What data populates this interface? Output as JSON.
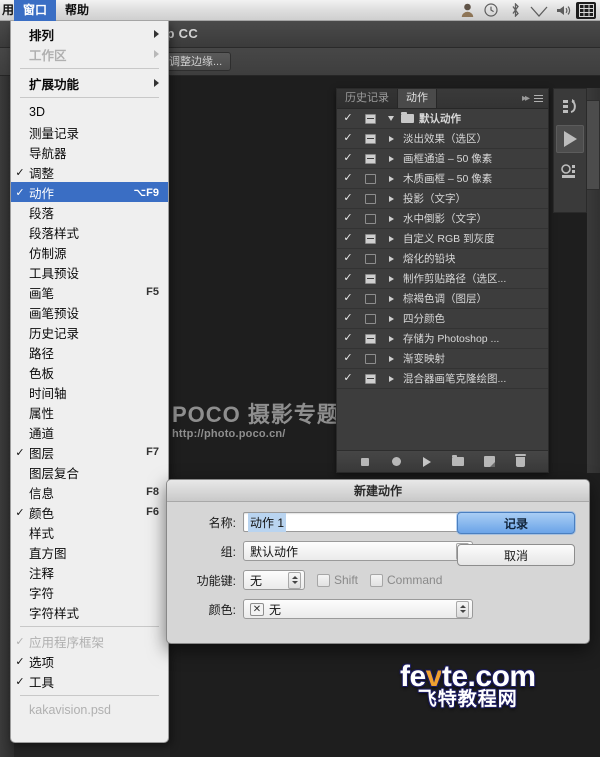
{
  "menubar": {
    "left_truncated": "用",
    "items": [
      {
        "label": "窗口",
        "selected": true
      },
      {
        "label": "帮助",
        "selected": false
      }
    ],
    "status_icons": [
      "user-icon",
      "clock-icon",
      "bluetooth-icon",
      "wifi-icon",
      "volume-icon",
      "input-method-icon"
    ]
  },
  "app": {
    "title": "hop CC",
    "refine_edge_button": "调整边缘..."
  },
  "window_menu": {
    "items": [
      {
        "label": "排列",
        "submenu": true,
        "checked": false,
        "disabled": false,
        "shortcut": ""
      },
      {
        "label": "工作区",
        "submenu": true,
        "checked": false,
        "disabled": true,
        "shortcut": ""
      },
      {
        "sep": true
      },
      {
        "label": "扩展功能",
        "submenu": true,
        "checked": false,
        "disabled": false,
        "shortcut": ""
      },
      {
        "sep": true
      },
      {
        "label": "3D",
        "submenu": false,
        "checked": false,
        "disabled": false,
        "shortcut": ""
      },
      {
        "label": "测量记录",
        "submenu": false,
        "checked": false,
        "disabled": false,
        "shortcut": ""
      },
      {
        "label": "导航器",
        "submenu": false,
        "checked": false,
        "disabled": false,
        "shortcut": ""
      },
      {
        "label": "调整",
        "submenu": false,
        "checked": true,
        "disabled": false,
        "shortcut": ""
      },
      {
        "label": "动作",
        "submenu": false,
        "checked": true,
        "disabled": false,
        "shortcut": "⌥F9",
        "highlighted": true
      },
      {
        "label": "段落",
        "submenu": false,
        "checked": false,
        "disabled": false,
        "shortcut": ""
      },
      {
        "label": "段落样式",
        "submenu": false,
        "checked": false,
        "disabled": false,
        "shortcut": ""
      },
      {
        "label": "仿制源",
        "submenu": false,
        "checked": false,
        "disabled": false,
        "shortcut": ""
      },
      {
        "label": "工具预设",
        "submenu": false,
        "checked": false,
        "disabled": false,
        "shortcut": ""
      },
      {
        "label": "画笔",
        "submenu": false,
        "checked": false,
        "disabled": false,
        "shortcut": "F5"
      },
      {
        "label": "画笔预设",
        "submenu": false,
        "checked": false,
        "disabled": false,
        "shortcut": ""
      },
      {
        "label": "历史记录",
        "submenu": false,
        "checked": false,
        "disabled": false,
        "shortcut": ""
      },
      {
        "label": "路径",
        "submenu": false,
        "checked": false,
        "disabled": false,
        "shortcut": ""
      },
      {
        "label": "色板",
        "submenu": false,
        "checked": false,
        "disabled": false,
        "shortcut": ""
      },
      {
        "label": "时间轴",
        "submenu": false,
        "checked": false,
        "disabled": false,
        "shortcut": ""
      },
      {
        "label": "属性",
        "submenu": false,
        "checked": false,
        "disabled": false,
        "shortcut": ""
      },
      {
        "label": "通道",
        "submenu": false,
        "checked": false,
        "disabled": false,
        "shortcut": ""
      },
      {
        "label": "图层",
        "submenu": false,
        "checked": true,
        "disabled": false,
        "shortcut": "F7"
      },
      {
        "label": "图层复合",
        "submenu": false,
        "checked": false,
        "disabled": false,
        "shortcut": ""
      },
      {
        "label": "信息",
        "submenu": false,
        "checked": false,
        "disabled": false,
        "shortcut": "F8"
      },
      {
        "label": "颜色",
        "submenu": false,
        "checked": true,
        "disabled": false,
        "shortcut": "F6"
      },
      {
        "label": "样式",
        "submenu": false,
        "checked": false,
        "disabled": false,
        "shortcut": ""
      },
      {
        "label": "直方图",
        "submenu": false,
        "checked": false,
        "disabled": false,
        "shortcut": ""
      },
      {
        "label": "注释",
        "submenu": false,
        "checked": false,
        "disabled": false,
        "shortcut": ""
      },
      {
        "label": "字符",
        "submenu": false,
        "checked": false,
        "disabled": false,
        "shortcut": ""
      },
      {
        "label": "字符样式",
        "submenu": false,
        "checked": false,
        "disabled": false,
        "shortcut": ""
      },
      {
        "sep": true
      },
      {
        "label": "应用程序框架",
        "submenu": false,
        "checked": true,
        "disabled": true,
        "shortcut": ""
      },
      {
        "label": "选项",
        "submenu": false,
        "checked": true,
        "disabled": false,
        "shortcut": ""
      },
      {
        "label": "工具",
        "submenu": false,
        "checked": true,
        "disabled": false,
        "shortcut": ""
      },
      {
        "sep": true
      },
      {
        "label": "kakavision.psd",
        "submenu": false,
        "checked": false,
        "disabled": true,
        "shortcut": ""
      }
    ]
  },
  "actions_panel": {
    "tabs": [
      {
        "label": "历史记录",
        "active": false
      },
      {
        "label": "动作",
        "active": true
      }
    ],
    "rows": [
      {
        "label": "默认动作",
        "checked": true,
        "dialog": "on",
        "expanded": true,
        "group": true
      },
      {
        "label": "淡出效果（选区）",
        "checked": true,
        "dialog": "on",
        "expanded": false,
        "group": false
      },
      {
        "label": "画框通道 – 50 像素",
        "checked": true,
        "dialog": "on",
        "expanded": false,
        "group": false
      },
      {
        "label": "木质画框 – 50 像素",
        "checked": true,
        "dialog": "off",
        "expanded": false,
        "group": false
      },
      {
        "label": "投影（文字）",
        "checked": true,
        "dialog": "off",
        "expanded": false,
        "group": false
      },
      {
        "label": "水中倒影（文字）",
        "checked": true,
        "dialog": "off",
        "expanded": false,
        "group": false
      },
      {
        "label": "自定义 RGB 到灰度",
        "checked": true,
        "dialog": "on",
        "expanded": false,
        "group": false
      },
      {
        "label": "熔化的铅块",
        "checked": true,
        "dialog": "off",
        "expanded": false,
        "group": false
      },
      {
        "label": "制作剪贴路径（选区...",
        "checked": true,
        "dialog": "on",
        "expanded": false,
        "group": false
      },
      {
        "label": "棕褐色调（图层）",
        "checked": true,
        "dialog": "off",
        "expanded": false,
        "group": false
      },
      {
        "label": "四分颜色",
        "checked": true,
        "dialog": "off",
        "expanded": false,
        "group": false
      },
      {
        "label": "存储为 Photoshop ...",
        "checked": true,
        "dialog": "on",
        "expanded": false,
        "group": false
      },
      {
        "label": "渐变映射",
        "checked": true,
        "dialog": "off",
        "expanded": false,
        "group": false
      },
      {
        "label": "混合器画笔克隆绘图...",
        "checked": true,
        "dialog": "on",
        "expanded": false,
        "group": false
      }
    ],
    "bottom_buttons": [
      "stop-icon",
      "record-icon",
      "play-icon",
      "new-set-icon",
      "new-action-icon",
      "delete-icon"
    ]
  },
  "right_dock": {
    "buttons": [
      "history-icon",
      "actions-play-icon",
      "mini-bridge-icon"
    ]
  },
  "dialog": {
    "title": "新建动作",
    "name_label": "名称:",
    "name_value": "动作 1",
    "group_label": "组:",
    "group_value": "默认动作",
    "fkey_label": "功能键:",
    "fkey_value": "无",
    "shift_label": "Shift",
    "command_label": "Command",
    "color_label": "颜色:",
    "color_value": "无",
    "color_swatch_glyph": "✕",
    "record_button": "记录",
    "cancel_button": "取消"
  },
  "watermarks": {
    "poco_line1": "POCO 摄影专题",
    "poco_line2": "http://photo.poco.cn/",
    "fevte_domain_pre": "fe",
    "fevte_domain_v": "v",
    "fevte_domain_post": "te.com",
    "fevte_cn": "飞特教程网"
  }
}
